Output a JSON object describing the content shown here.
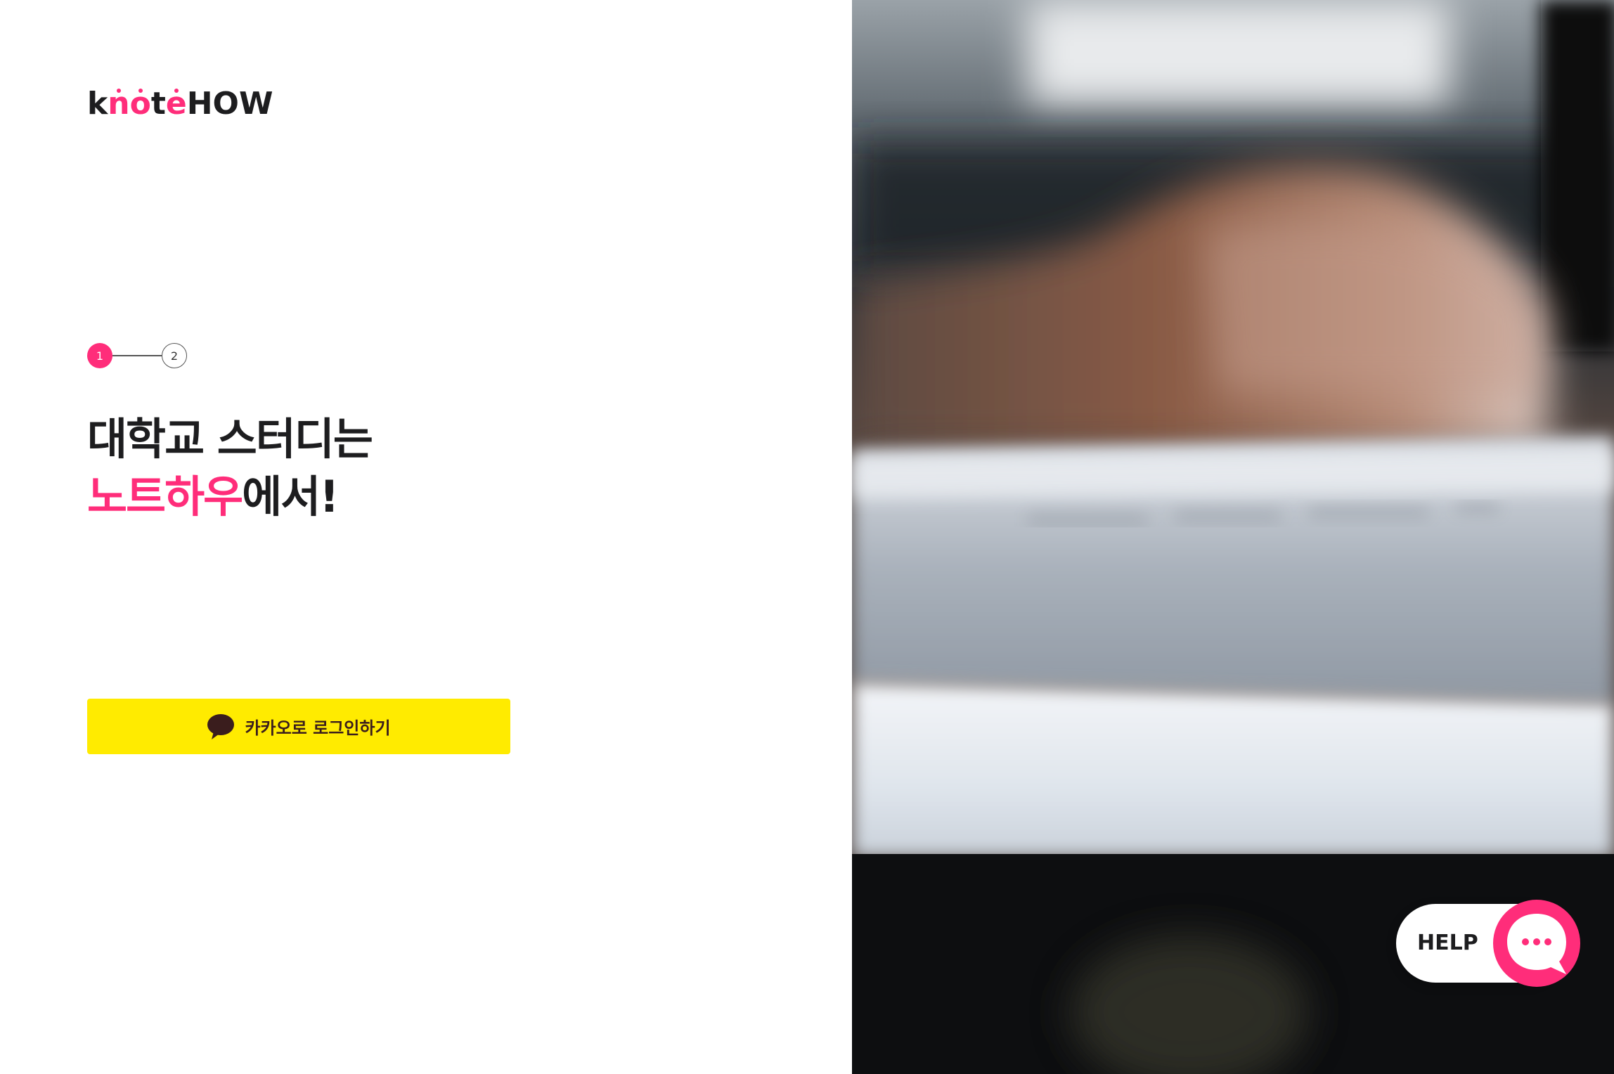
{
  "brand": {
    "logo_k": "k",
    "logo_n": "n",
    "logo_o": "o",
    "logo_t": "t",
    "logo_e": "e",
    "logo_how": "HOW",
    "accent_color": "#ff2d7a"
  },
  "stepper": {
    "steps": [
      {
        "number": "1",
        "state": "active"
      },
      {
        "number": "2",
        "state": "inactive"
      }
    ]
  },
  "headline": {
    "line1": "대학교 스터디는",
    "line2_highlight": "노트하우",
    "line2_rest": "에서!"
  },
  "login": {
    "kakao_label": "카카오로 로그인하기",
    "icon": "kakao-speech-bubble-icon",
    "button_color": "#ffeb00"
  },
  "help": {
    "label": "HELP",
    "icon": "chat-bubble-icon"
  }
}
